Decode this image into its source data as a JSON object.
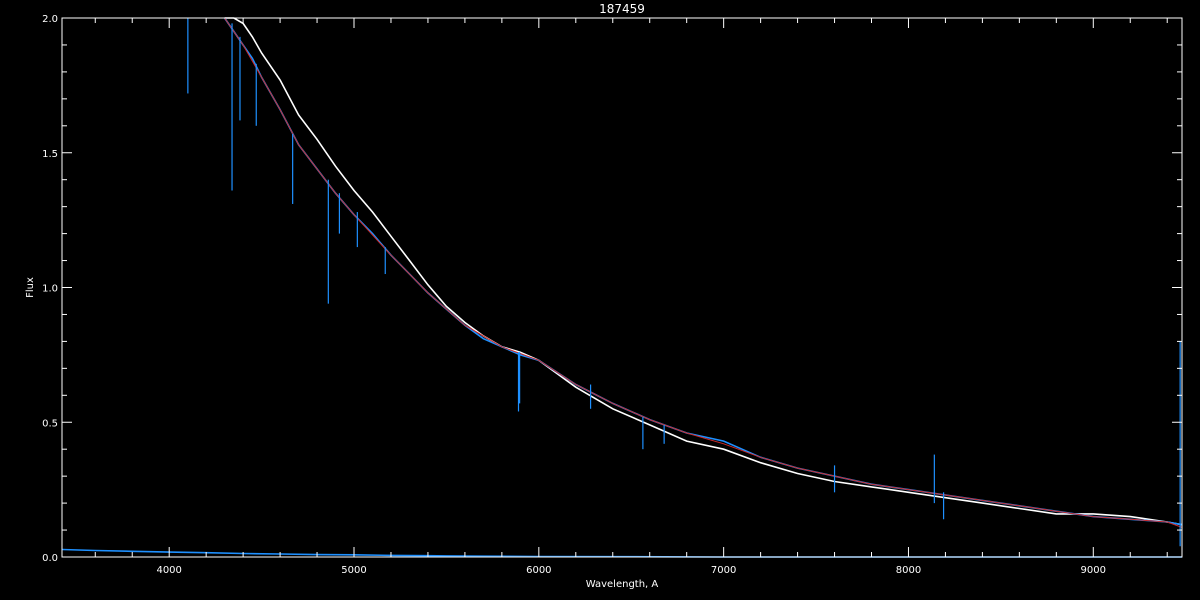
{
  "chart_data": {
    "type": "line",
    "title": "187459",
    "xlabel": "Wavelength, A",
    "ylabel": "Flux",
    "xlim": [
      3420,
      9480
    ],
    "ylim": [
      0.0,
      2.0
    ],
    "grid": false,
    "background": "#000000",
    "x_ticks": [
      4000,
      5000,
      6000,
      7000,
      8000,
      9000
    ],
    "x_tick_labels": [
      "4000",
      "5000",
      "6000",
      "7000",
      "8000",
      "9000"
    ],
    "y_ticks": [
      0.0,
      0.5,
      1.0,
      1.5,
      2.0
    ],
    "y_tick_labels": [
      "0.0",
      "0.5",
      "1.0",
      "1.5",
      "2.0"
    ],
    "series": [
      {
        "color": "#ffffff",
        "x": [
          4300,
          4350,
          4400,
          4450,
          4500,
          4600,
          4700,
          4800,
          4900,
          5000,
          5100,
          5200,
          5300,
          5400,
          5500,
          5600,
          5700,
          5800,
          5900,
          6000,
          6200,
          6400,
          6600,
          6800,
          7000,
          7200,
          7400,
          7600,
          7800,
          8000,
          8200,
          8400,
          8600,
          8800,
          9000,
          9200,
          9400,
          9480
        ],
        "y": [
          2.0,
          2.0,
          1.98,
          1.93,
          1.87,
          1.77,
          1.64,
          1.55,
          1.45,
          1.36,
          1.28,
          1.19,
          1.1,
          1.01,
          0.93,
          0.87,
          0.82,
          0.78,
          0.76,
          0.73,
          0.63,
          0.55,
          0.49,
          0.43,
          0.4,
          0.35,
          0.31,
          0.28,
          0.26,
          0.24,
          0.22,
          0.2,
          0.18,
          0.16,
          0.16,
          0.15,
          0.13,
          0.12
        ]
      },
      {
        "color": "#1e90ff",
        "x": [
          4300,
          4350,
          4400,
          4450,
          4500,
          4600,
          4700,
          4800,
          4900,
          5000,
          5100,
          5200,
          5300,
          5400,
          5500,
          5600,
          5700,
          5800,
          5900,
          6000,
          6200,
          6400,
          6600,
          6800,
          7000,
          7200,
          7400,
          7600,
          7800,
          8000,
          8200,
          8400,
          8600,
          8800,
          9000,
          9200,
          9400,
          9480
        ],
        "y": [
          2.0,
          1.95,
          1.9,
          1.85,
          1.78,
          1.66,
          1.53,
          1.44,
          1.35,
          1.27,
          1.2,
          1.12,
          1.05,
          0.98,
          0.92,
          0.86,
          0.81,
          0.78,
          0.75,
          0.73,
          0.64,
          0.57,
          0.51,
          0.46,
          0.43,
          0.37,
          0.33,
          0.3,
          0.27,
          0.25,
          0.23,
          0.21,
          0.19,
          0.17,
          0.15,
          0.14,
          0.13,
          0.12
        ]
      },
      {
        "color": "#cc2a2a",
        "x": [
          4300,
          4400,
          4500,
          4600,
          4700,
          4800,
          4900,
          5000,
          5200,
          5400,
          5600,
          5800,
          6000,
          6200,
          6400,
          6600,
          6800,
          7000,
          7200,
          7400,
          7600,
          7800,
          8000,
          8200,
          8400,
          8600,
          8800,
          9000,
          9200,
          9400,
          9480
        ],
        "y": [
          2.0,
          1.9,
          1.78,
          1.66,
          1.53,
          1.44,
          1.35,
          1.27,
          1.12,
          0.98,
          0.86,
          0.78,
          0.73,
          0.64,
          0.57,
          0.51,
          0.46,
          0.42,
          0.37,
          0.33,
          0.3,
          0.27,
          0.25,
          0.23,
          0.21,
          0.19,
          0.17,
          0.15,
          0.14,
          0.13,
          0.11
        ]
      },
      {
        "color": "#1e90ff",
        "x": [
          3420,
          3600,
          3800,
          4000,
          4200,
          4400,
          4600,
          4800,
          5000,
          5200,
          5400,
          5500,
          5700,
          6000,
          6500,
          7000,
          8000,
          9480
        ],
        "y": [
          0.028,
          0.024,
          0.021,
          0.018,
          0.016,
          0.013,
          0.011,
          0.009,
          0.008,
          0.006,
          0.005,
          0.004,
          0.003,
          0.002,
          0.001,
          0.0,
          0.0,
          0.0
        ]
      }
    ],
    "absorption_lines": [
      {
        "x": 4101,
        "y_top": 2.0,
        "y_bottom": 1.72,
        "color": "#1e90ff"
      },
      {
        "x": 4340,
        "y_top": 1.98,
        "y_bottom": 1.36,
        "color": "#1e90ff"
      },
      {
        "x": 4383,
        "y_top": 1.93,
        "y_bottom": 1.62,
        "color": "#1e90ff"
      },
      {
        "x": 4471,
        "y_top": 1.83,
        "y_bottom": 1.6,
        "color": "#1e90ff"
      },
      {
        "x": 4668,
        "y_top": 1.57,
        "y_bottom": 1.31,
        "color": "#1e90ff"
      },
      {
        "x": 4861,
        "y_top": 1.4,
        "y_bottom": 0.94,
        "color": "#1e90ff"
      },
      {
        "x": 4921,
        "y_top": 1.35,
        "y_bottom": 1.2,
        "color": "#1e90ff"
      },
      {
        "x": 5018,
        "y_top": 1.28,
        "y_bottom": 1.15,
        "color": "#1e90ff"
      },
      {
        "x": 5169,
        "y_top": 1.15,
        "y_bottom": 1.05,
        "color": "#1e90ff"
      },
      {
        "x": 5890,
        "y_top": 0.76,
        "y_bottom": 0.54,
        "color": "#1e90ff"
      },
      {
        "x": 5896,
        "y_top": 0.76,
        "y_bottom": 0.57,
        "color": "#1e90ff"
      },
      {
        "x": 6280,
        "y_top": 0.64,
        "y_bottom": 0.55,
        "color": "#1e90ff"
      },
      {
        "x": 6563,
        "y_top": 0.52,
        "y_bottom": 0.4,
        "color": "#1e90ff"
      },
      {
        "x": 6678,
        "y_top": 0.49,
        "y_bottom": 0.42,
        "color": "#1e90ff"
      },
      {
        "x": 7600,
        "y_top": 0.34,
        "y_bottom": 0.24,
        "color": "#1e90ff"
      },
      {
        "x": 8140,
        "y_top": 0.38,
        "y_bottom": 0.2,
        "color": "#1e90ff"
      },
      {
        "x": 8190,
        "y_top": 0.24,
        "y_bottom": 0.14,
        "color": "#1e90ff"
      },
      {
        "x": 9470,
        "y_top": 0.8,
        "y_bottom": 0.04,
        "color": "#1e90ff"
      }
    ]
  }
}
